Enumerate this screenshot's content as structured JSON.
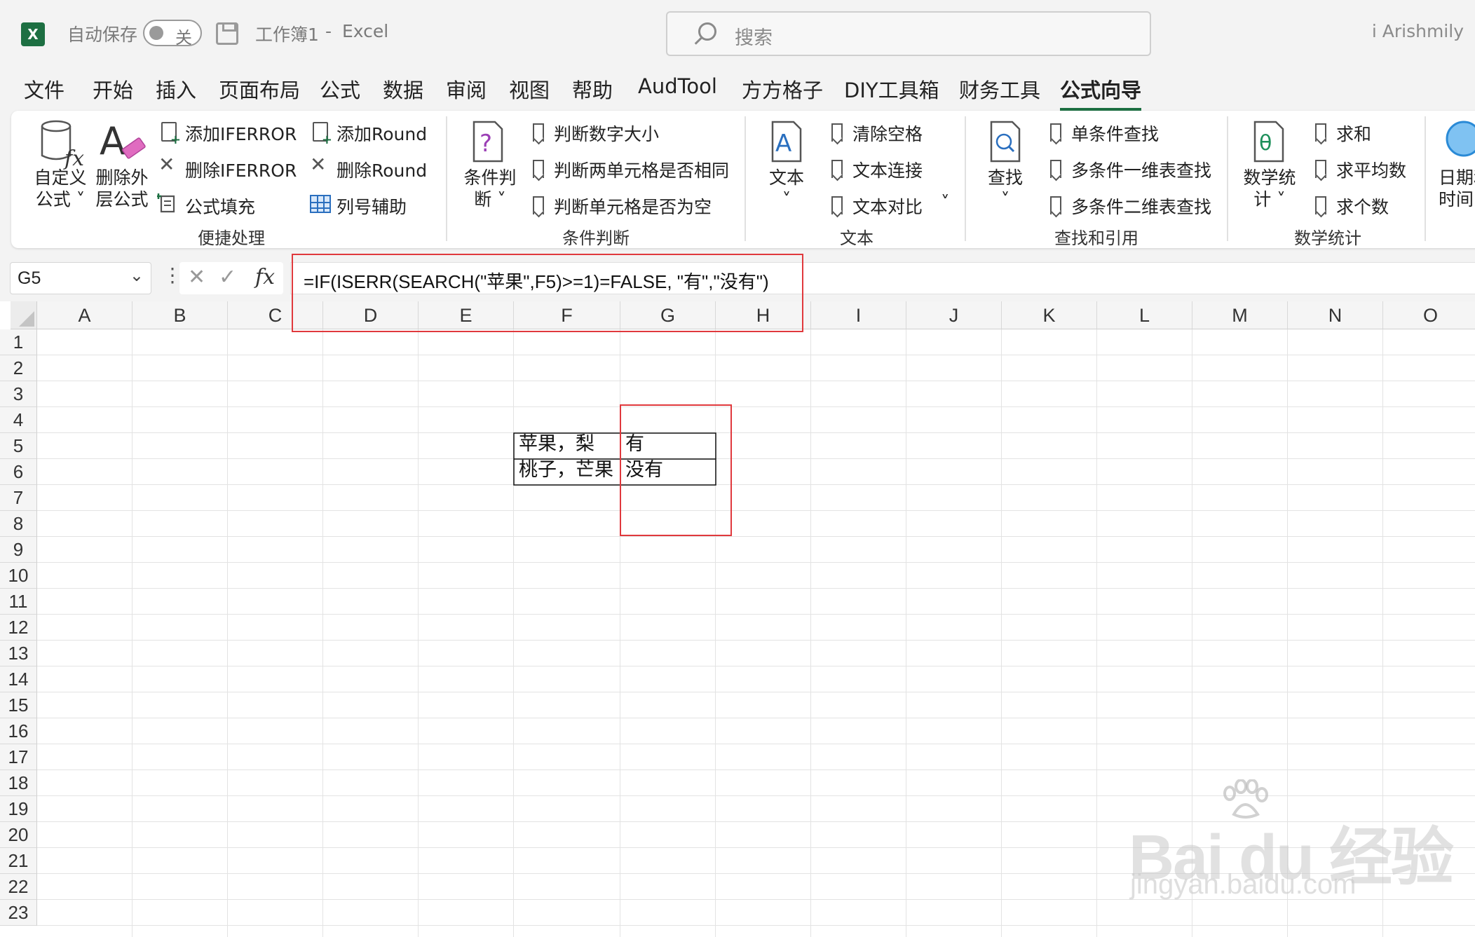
{
  "titlebar": {
    "autosave_label": "自动保存",
    "autosave_toggle": "关",
    "workbook": "工作簿1",
    "dash": "-",
    "app": "Excel",
    "search_placeholder": "搜索",
    "user": "i Arishmily"
  },
  "tabs": [
    "文件",
    "开始",
    "插入",
    "页面布局",
    "公式",
    "数据",
    "审阅",
    "视图",
    "帮助",
    "AudTool",
    "方方格子",
    "DIY工具箱",
    "财务工具",
    "公式向导"
  ],
  "active_tab": "公式向导",
  "ribbon": {
    "group1": {
      "label": "便捷处理",
      "big1_l1": "自定义",
      "big1_l2": "公式 ˅",
      "big2_l1": "删除外",
      "big2_l2": "层公式",
      "add_iferror": "添加IFERROR",
      "del_iferror": "删除IFERROR",
      "fill_formula": "公式填充",
      "add_round": "添加Round",
      "del_round": "删除Round",
      "col_helper": "列号辅助"
    },
    "group2": {
      "label": "条件判断",
      "big_l1": "条件判",
      "big_l2": "断 ˅",
      "item1": "判断数字大小",
      "item2": "判断两单元格是否相同",
      "item3": "判断单元格是否为空"
    },
    "group3": {
      "label": "文本",
      "big_l1": "文本",
      "big_l2": "˅",
      "item1": "清除空格",
      "item2": "文本连接",
      "item3": "文本对比",
      "item3_chev": "˅"
    },
    "group4": {
      "label": "查找和引用",
      "big_l1": "查找",
      "big_l2": "˅",
      "item1": "单条件查找",
      "item2": "多条件一维表查找",
      "item3": "多条件二维表查找"
    },
    "group5": {
      "label": "数学统计",
      "big_l1": "数学统",
      "big_l2": "计 ˅",
      "item1": "求和",
      "item2": "求平均数",
      "item3": "求个数"
    },
    "group6": {
      "big_l1": "日期和",
      "big_l2": "时间"
    }
  },
  "formula_bar": {
    "name_box": "G5",
    "formula": "=IF(ISERR(SEARCH(\"苹果\",F5)>=1)=FALSE, \"有\",\"没有\")",
    "fx": "fx",
    "cancel": "✕",
    "confirm": "✓"
  },
  "columns": [
    "A",
    "B",
    "C",
    "D",
    "E",
    "F",
    "G",
    "H",
    "I",
    "J",
    "K",
    "L",
    "M",
    "N",
    "O"
  ],
  "rows": [
    "1",
    "2",
    "3",
    "4",
    "5",
    "6",
    "7",
    "8",
    "9",
    "10",
    "11",
    "12",
    "13",
    "14",
    "15",
    "16",
    "17",
    "18",
    "19",
    "20",
    "21",
    "22",
    "23"
  ],
  "cells": {
    "F5": "苹果，梨",
    "G5": "有",
    "F6": "桃子，芒果",
    "G6": "没有"
  },
  "watermark": {
    "brand": "Bai du 经验",
    "url": "jingyan.baidu.com"
  },
  "colors": {
    "excel_green": "#1d6f42",
    "highlight_red": "#e0393d"
  }
}
